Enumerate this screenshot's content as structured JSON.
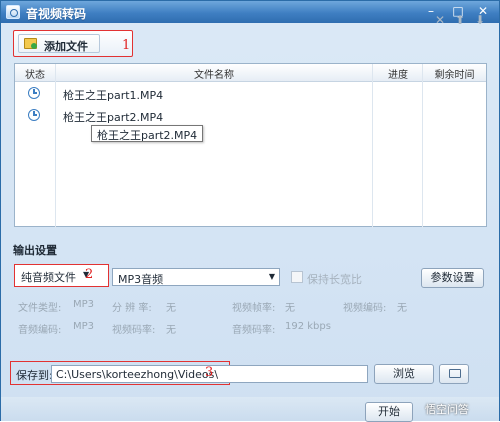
{
  "window": {
    "title": "音视频转码",
    "controls": {
      "minimize": "–",
      "restore": "□",
      "close": "✕"
    }
  },
  "toolbar": {
    "add_file_label": "添加文件",
    "annotation": "1",
    "icons": [
      "delete-icon",
      "arrow-up-icon",
      "arrow-down-icon"
    ]
  },
  "file_list": {
    "columns": [
      "状态",
      "文件名称",
      "进度",
      "剩余时间"
    ],
    "rows": [
      {
        "status_icon": "clock-icon",
        "name": "枪王之王part1.MP4"
      },
      {
        "status_icon": "clock-icon",
        "name": "枪王之王part2.MP4"
      }
    ],
    "tooltip": "枪王之王part2.MP4"
  },
  "output": {
    "section_title": "输出设置",
    "type_select": "纯音频文件",
    "type_annotation": "2",
    "format_select": "MP3音频",
    "keep_ratio_label": "保持长宽比",
    "param_button": "参数设置",
    "info": {
      "file_type_label": "文件类型:",
      "file_type_value": "MP3",
      "resolution_label": "分 辨 率:",
      "resolution_value": "无",
      "video_fps_label": "视频帧率:",
      "video_fps_value": "无",
      "video_codec_label": "视频编码:",
      "video_codec_value": "无",
      "audio_codec_label": "音频编码:",
      "audio_codec_value": "MP3",
      "video_bitrate_label": "视频码率:",
      "video_bitrate_value": "无",
      "audio_bitrate_label": "音频码率:",
      "audio_bitrate_value": "192 kbps"
    }
  },
  "save": {
    "label": "保存到:",
    "path": "C:\\Users\\korteezhong\\Videos\\",
    "annotation": "3",
    "browse_button": "浏览"
  },
  "footer": {
    "start_button": "开始",
    "watermark": "悟空问答"
  }
}
